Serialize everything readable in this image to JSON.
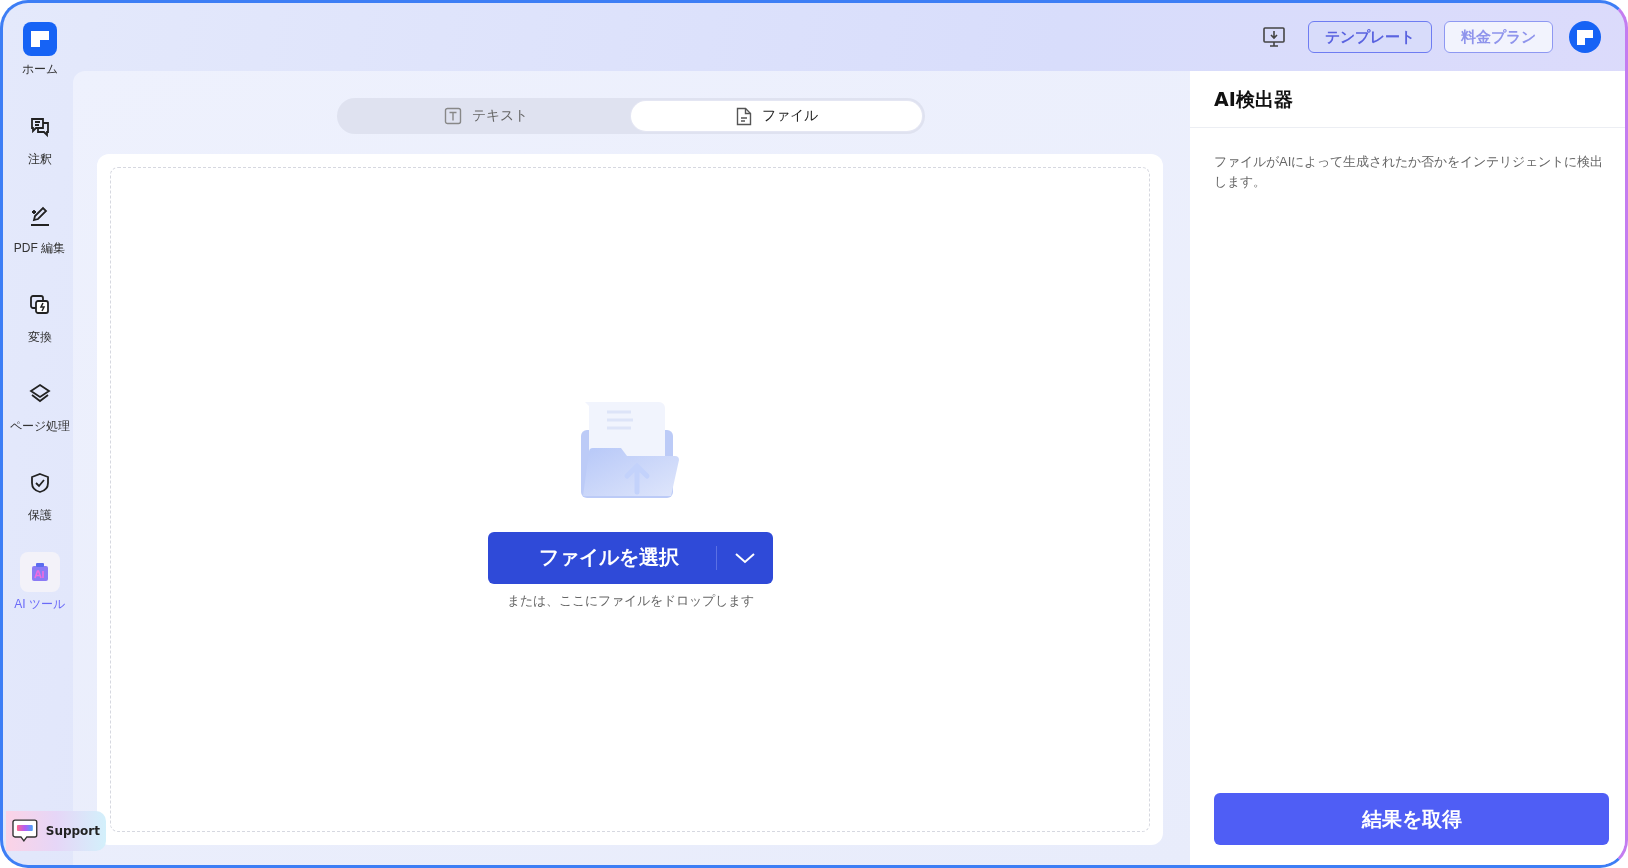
{
  "sidebar": {
    "items": [
      {
        "label": "ホーム",
        "kind": "logo",
        "selected": false
      },
      {
        "label": "注釈",
        "kind": "comment",
        "selected": false
      },
      {
        "label": "PDF 編集",
        "kind": "edit",
        "selected": false
      },
      {
        "label": "変換",
        "kind": "convert",
        "selected": false
      },
      {
        "label": "ページ処理",
        "kind": "layers",
        "selected": false
      },
      {
        "label": "保護",
        "kind": "shield",
        "selected": false
      },
      {
        "label": "AI ツール",
        "kind": "ai",
        "selected": true
      }
    ],
    "support": {
      "label": "Support"
    }
  },
  "top_bar": {
    "buttons": [
      {
        "label": "テンプレート",
        "kind": "primary"
      },
      {
        "label": "料金プラン",
        "kind": "soft"
      }
    ]
  },
  "tabs": [
    {
      "label": "テキスト",
      "kind": "text",
      "selected": false
    },
    {
      "label": "ファイル",
      "kind": "file",
      "selected": true
    }
  ],
  "upload": {
    "button": "ファイルを選択",
    "hint": "または、ここにファイルをドロップします"
  },
  "panel": {
    "title": "AI検出器",
    "description": "ファイルがAIによって生成されたか否かをインテリジェントに検出します。",
    "action": "結果を取得"
  }
}
